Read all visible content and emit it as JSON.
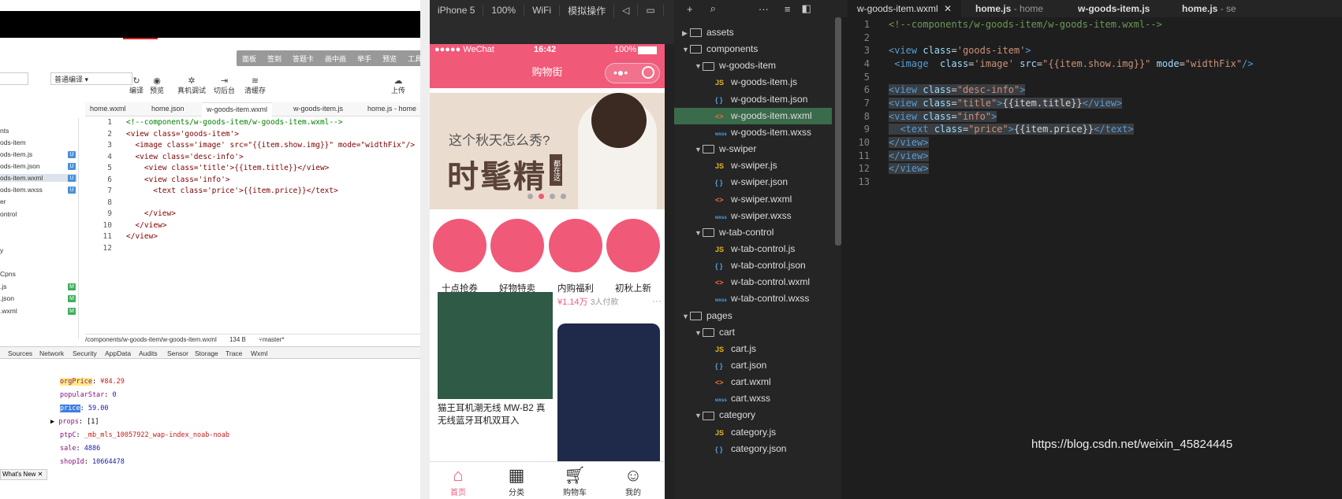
{
  "left_panel": {
    "toolbar_top": [
      "面板",
      "签到",
      "答题卡",
      "画中画",
      "举手",
      "预览",
      "工具"
    ],
    "compile_mode": "普通编译",
    "tools": [
      "编译",
      "预览",
      "真机调试",
      "切后台",
      "清缓存",
      "上传"
    ],
    "tabs": [
      "home.wxml",
      "home.json",
      "w-goods-item.wxml",
      "w-goods-item.js",
      "home.js - home"
    ],
    "file_tree": [
      {
        "label": "nts",
        "badge": ""
      },
      {
        "label": "ods-item",
        "badge": ""
      },
      {
        "label": "ods-item.js",
        "badge": "U"
      },
      {
        "label": "ods-item.json",
        "badge": "U"
      },
      {
        "label": "ods-item.wxml",
        "badge": "U"
      },
      {
        "label": "ods-item.wxss",
        "badge": "U"
      },
      {
        "label": "er",
        "badge": ""
      },
      {
        "label": "ontrol",
        "badge": ""
      },
      {
        "label": "y",
        "badge": ""
      },
      {
        "label": "Cpns",
        "badge": ""
      },
      {
        "label": ".js",
        "badge": "M"
      },
      {
        "label": ".json",
        "badge": "M"
      },
      {
        "label": ".wxml",
        "badge": "M"
      }
    ],
    "code": [
      {
        "n": "1",
        "t": "<!--components/w-goods-item/w-goods-item.wxml-->"
      },
      {
        "n": "2",
        "t": "<view class='goods-item'>"
      },
      {
        "n": "3",
        "t": "  <image class='image' src=\"{{item.show.img}}\" mode=\"widthFix\"/>"
      },
      {
        "n": "4",
        "t": "  <view class='desc-info'>"
      },
      {
        "n": "5",
        "t": "    <view class='title'>{{item.title}}</view>"
      },
      {
        "n": "6",
        "t": "    <view class='info'>"
      },
      {
        "n": "7",
        "t": "      <text class='price'>{{item.price}}</text>"
      },
      {
        "n": "8",
        "t": ""
      },
      {
        "n": "9",
        "t": "    </view>"
      },
      {
        "n": "10",
        "t": "  </view>"
      },
      {
        "n": "11",
        "t": "</view>"
      },
      {
        "n": "12",
        "t": ""
      }
    ],
    "status_path": "/components/w-goods-item/w-goods-item.wxml",
    "status_size": "134 B",
    "status_branch": "master*",
    "devtools_tabs": [
      "Sources",
      "Network",
      "Security",
      "AppData",
      "Audits",
      "Sensor",
      "Storage",
      "Trace",
      "Wxml"
    ],
    "console": [
      {
        "key": "orgPrice",
        "val": "¥84.29"
      },
      {
        "key": "popularStar",
        "val": "0"
      },
      {
        "key": "price",
        "val": "59.00"
      },
      {
        "key": "props",
        "val": "[1]"
      },
      {
        "key": "ptpC",
        "val": "_mb_mls_10057922_wap-index_noab-noab"
      },
      {
        "key": "sale",
        "val": "4886"
      },
      {
        "key": "shopId",
        "val": "10664478"
      }
    ],
    "whats_new": "What's New"
  },
  "phone": {
    "toolbar": [
      "iPhone 5",
      "100%",
      "WiFi",
      "模拟操作"
    ],
    "status_carrier": "●●●●● WeChat",
    "status_time": "16:42",
    "status_battery": "100%",
    "nav_title": "购物街",
    "banner_line1": "这个秋天怎么秀?",
    "banner_line2": "时髦精",
    "banner_tag": "都在这",
    "categories": [
      "十点抢券",
      "好物特卖",
      "内购福利",
      "初秋上新"
    ],
    "product1_title": "猫王耳机潮无线 MW-B2 真无线蓝牙耳机双耳入",
    "product2_price": "¥1.14万",
    "product2_count": "3人付款",
    "tabbar": [
      "首页",
      "分类",
      "购物车",
      "我的"
    ]
  },
  "explorer": {
    "items": [
      {
        "label": "assets",
        "kind": "folder",
        "depth": 0,
        "open": false
      },
      {
        "label": "components",
        "kind": "folder",
        "depth": 0,
        "open": true
      },
      {
        "label": "w-goods-item",
        "kind": "folder",
        "depth": 1,
        "open": true
      },
      {
        "label": "w-goods-item.js",
        "kind": "js",
        "depth": 2
      },
      {
        "label": "w-goods-item.json",
        "kind": "json",
        "depth": 2
      },
      {
        "label": "w-goods-item.wxml",
        "kind": "wxml",
        "depth": 2,
        "selected": true
      },
      {
        "label": "w-goods-item.wxss",
        "kind": "wxss",
        "depth": 2
      },
      {
        "label": "w-swiper",
        "kind": "folder",
        "depth": 1,
        "open": true
      },
      {
        "label": "w-swiper.js",
        "kind": "js",
        "depth": 2
      },
      {
        "label": "w-swiper.json",
        "kind": "json",
        "depth": 2
      },
      {
        "label": "w-swiper.wxml",
        "kind": "wxml",
        "depth": 2
      },
      {
        "label": "w-swiper.wxss",
        "kind": "wxss",
        "depth": 2
      },
      {
        "label": "w-tab-control",
        "kind": "folder",
        "depth": 1,
        "open": true
      },
      {
        "label": "w-tab-control.js",
        "kind": "js",
        "depth": 2
      },
      {
        "label": "w-tab-control.json",
        "kind": "json",
        "depth": 2
      },
      {
        "label": "w-tab-control.wxml",
        "kind": "wxml",
        "depth": 2
      },
      {
        "label": "w-tab-control.wxss",
        "kind": "wxss",
        "depth": 2
      },
      {
        "label": "pages",
        "kind": "folder",
        "depth": 0,
        "open": true
      },
      {
        "label": "cart",
        "kind": "folder",
        "depth": 1,
        "open": true
      },
      {
        "label": "cart.js",
        "kind": "js",
        "depth": 2
      },
      {
        "label": "cart.json",
        "kind": "json",
        "depth": 2
      },
      {
        "label": "cart.wxml",
        "kind": "wxml",
        "depth": 2
      },
      {
        "label": "cart.wxss",
        "kind": "wxss",
        "depth": 2
      },
      {
        "label": "category",
        "kind": "folder",
        "depth": 1,
        "open": true
      },
      {
        "label": "category.js",
        "kind": "js",
        "depth": 2
      },
      {
        "label": "category.json",
        "kind": "json",
        "depth": 2
      }
    ]
  },
  "editor": {
    "tabs": [
      {
        "label": "w-goods-item.wxml",
        "sub": "",
        "active": true
      },
      {
        "label": "home.js",
        "sub": "- home",
        "active": false
      },
      {
        "label": "w-goods-item.js",
        "sub": "",
        "active": false
      },
      {
        "label": "home.js",
        "sub": "- se",
        "active": false
      }
    ],
    "lines": [
      {
        "n": "1",
        "html": "<span class='c-com'>&lt;!--components/w-goods-item/w-goods-item.wxml--&gt;</span>",
        "sel": false
      },
      {
        "n": "2",
        "html": "",
        "sel": false
      },
      {
        "n": "3",
        "html": "<span class='c-tag'>&lt;view</span> <span class='c-attr'>class</span><span class='c-txt'>=</span><span class='c-str'>'goods-item'</span><span class='c-tag'>&gt;</span>",
        "sel": false
      },
      {
        "n": "4",
        "html": " <span class='c-tag'>&lt;image</span>  <span class='c-attr'>class</span><span class='c-txt'>=</span><span class='c-str'>'image'</span> <span class='c-attr'>src</span><span class='c-txt'>=</span><span class='c-str'>\"{{item.show.img}}\"</span> <span class='c-attr'>mode</span><span class='c-txt'>=</span><span class='c-str'>\"widthFix\"</span><span class='c-tag'>/&gt;</span>",
        "sel": false
      },
      {
        "n": "5",
        "html": "",
        "sel": false
      },
      {
        "n": "6",
        "html": "<span class='c-tag'>&lt;view</span> <span class='c-attr'>class</span><span class='c-txt'>=</span><span class='c-str'>\"desc-info\"</span><span class='c-tag'>&gt;</span>",
        "sel": true
      },
      {
        "n": "7",
        "html": "<span class='c-tag'>&lt;view</span> <span class='c-attr'>class</span><span class='c-txt'>=</span><span class='c-str'>\"title\"</span><span class='c-tag'>&gt;</span><span class='c-txt'>{{item.title}}</span><span class='c-tag'>&lt;/view&gt;</span>",
        "sel": true
      },
      {
        "n": "8",
        "html": "<span class='c-tag'>&lt;view</span> <span class='c-attr'>class</span><span class='c-txt'>=</span><span class='c-str'>\"info\"</span><span class='c-tag'>&gt;</span>",
        "sel": true
      },
      {
        "n": "9",
        "html": "  <span class='c-tag'>&lt;text</span> <span class='c-attr'>class</span><span class='c-txt'>=</span><span class='c-str'>\"price\"</span><span class='c-tag'>&gt;</span><span class='c-txt'>{{item.price}}</span><span class='c-tag'>&lt;/text&gt;</span>",
        "sel": true
      },
      {
        "n": "10",
        "html": "<span class='c-tag'>&lt;/view&gt;</span>",
        "sel": true
      },
      {
        "n": "11",
        "html": "<span class='c-tag'>&lt;/view&gt;</span>",
        "sel": true
      },
      {
        "n": "12",
        "html": "<span class='c-tag'>&lt;/view&gt;</span>",
        "sel": true
      },
      {
        "n": "13",
        "html": "",
        "sel": false
      }
    ]
  },
  "watermark": "https://blog.csdn.net/weixin_45824445"
}
